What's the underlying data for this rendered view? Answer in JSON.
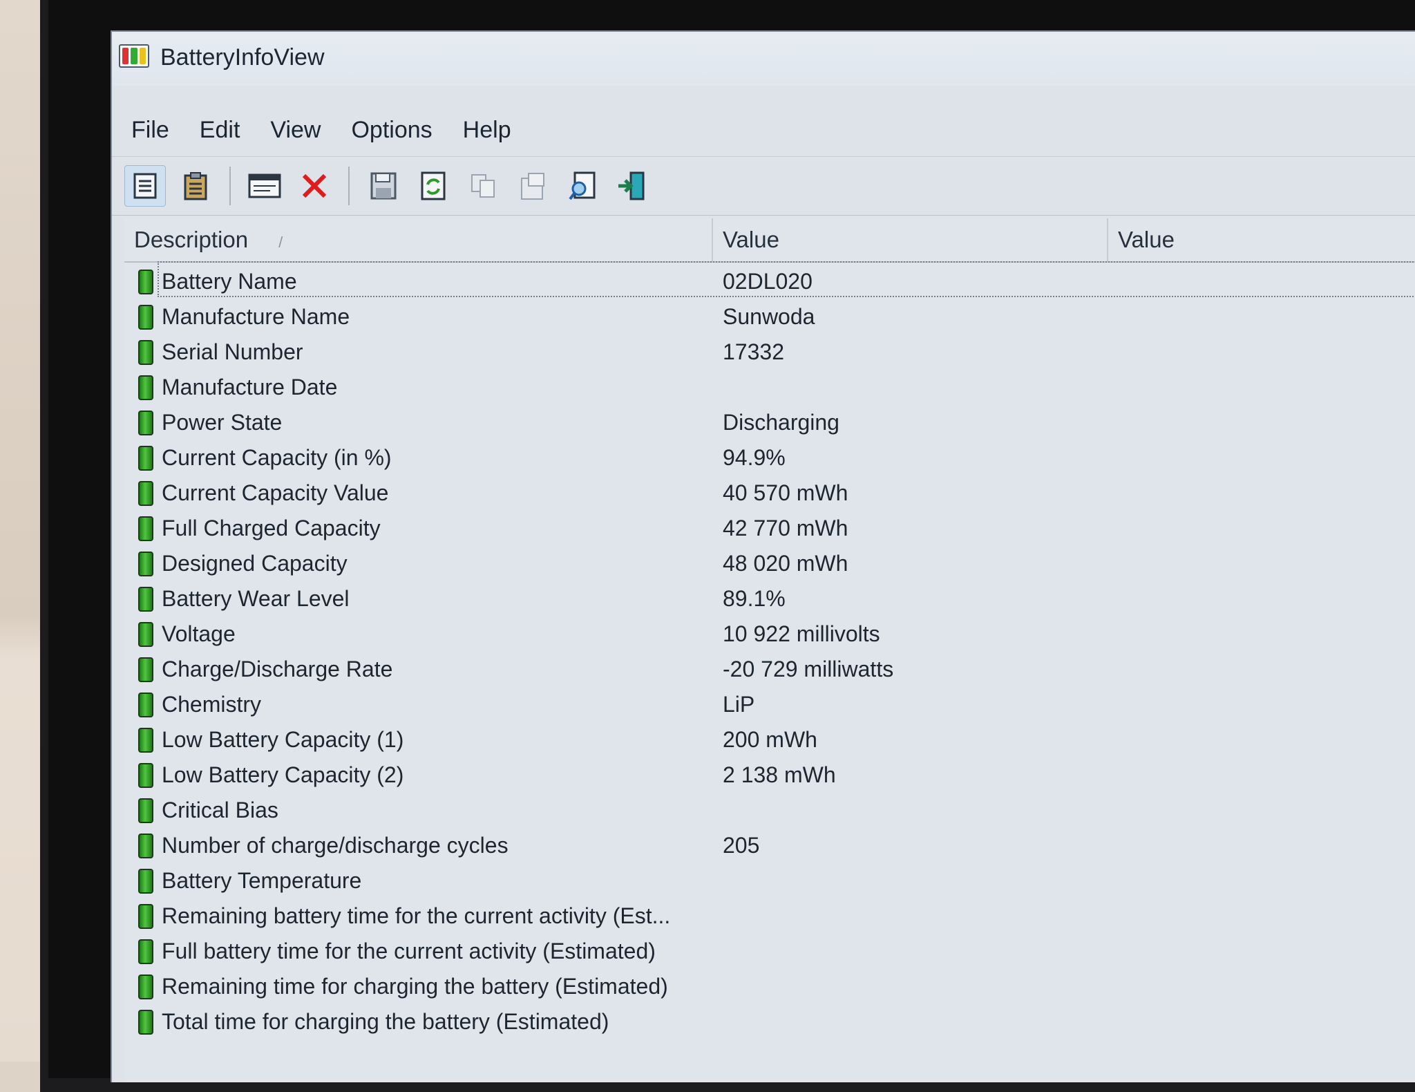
{
  "window": {
    "title": "BatteryInfoView"
  },
  "menu": [
    {
      "label": "File"
    },
    {
      "label": "Edit"
    },
    {
      "label": "View"
    },
    {
      "label": "Options"
    },
    {
      "label": "Help"
    }
  ],
  "toolbar": {
    "buttons": [
      {
        "icon": "show-pane-icon"
      },
      {
        "icon": "log-pane-icon"
      },
      {
        "icon": "html-report-icon"
      },
      {
        "icon": "delete-icon"
      },
      {
        "icon": "save-icon"
      },
      {
        "icon": "refresh-icon"
      },
      {
        "icon": "copy-icon"
      },
      {
        "icon": "properties-icon"
      },
      {
        "icon": "find-icon"
      },
      {
        "icon": "exit-icon"
      }
    ]
  },
  "columns": {
    "description": "Description",
    "value1": "Value",
    "value2": "Value"
  },
  "rows": [
    {
      "description": "Battery Name",
      "value": "02DL020"
    },
    {
      "description": "Manufacture Name",
      "value": "Sunwoda"
    },
    {
      "description": "Serial Number",
      "value": "17332"
    },
    {
      "description": "Manufacture Date",
      "value": ""
    },
    {
      "description": "Power State",
      "value": "Discharging"
    },
    {
      "description": "Current Capacity (in %)",
      "value": "94.9%"
    },
    {
      "description": "Current Capacity Value",
      "value": "40 570 mWh"
    },
    {
      "description": "Full Charged Capacity",
      "value": "42 770 mWh"
    },
    {
      "description": "Designed Capacity",
      "value": "48 020 mWh"
    },
    {
      "description": "Battery Wear Level",
      "value": "89.1%"
    },
    {
      "description": "Voltage",
      "value": "10 922 millivolts"
    },
    {
      "description": "Charge/Discharge Rate",
      "value": "-20 729 milliwatts"
    },
    {
      "description": "Chemistry",
      "value": "LiP"
    },
    {
      "description": "Low Battery Capacity (1)",
      "value": "200 mWh"
    },
    {
      "description": "Low Battery Capacity (2)",
      "value": "2 138 mWh"
    },
    {
      "description": "Critical Bias",
      "value": ""
    },
    {
      "description": "Number of charge/discharge cycles",
      "value": "205"
    },
    {
      "description": "Battery Temperature",
      "value": ""
    },
    {
      "description": "Remaining battery time for the current activity (Est...",
      "value": ""
    },
    {
      "description": "Full battery time for the current activity (Estimated)",
      "value": ""
    },
    {
      "description": "Remaining time for charging the battery (Estimated)",
      "value": ""
    },
    {
      "description": "Total  time for charging the battery (Estimated)",
      "value": ""
    }
  ]
}
